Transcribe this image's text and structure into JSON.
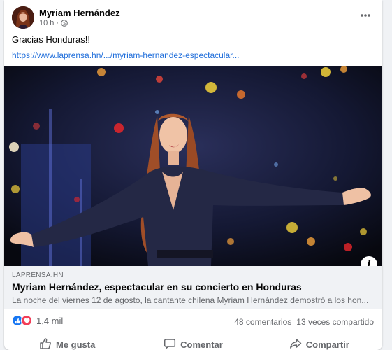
{
  "post": {
    "author": "Myriam Hernández",
    "time": "10 h",
    "separator": "·",
    "audience_icon": "globe-icon",
    "caption": "Gracias Honduras!!",
    "link_text": "https://www.laprensa.hn/.../myriam-hernandez-espectacular..."
  },
  "preview": {
    "domain": "LAPRENSA.HN",
    "title": "Myriam Hernández, espectacular en su concierto en Honduras",
    "description": "La noche del viernes 12 de agosto, la cantante chilena Myriam Hernández demostró a los hon..."
  },
  "stats": {
    "reaction_count": "1,4 mil",
    "comments": "48 comentarios",
    "shares": "13 veces compartido"
  },
  "actions": {
    "like": "Me gusta",
    "comment": "Comentar",
    "share": "Compartir"
  },
  "colors": {
    "link": "#216fdb",
    "like_blue": "#1877f2",
    "love_red": "#f33e58",
    "muted_text": "#65676b"
  }
}
